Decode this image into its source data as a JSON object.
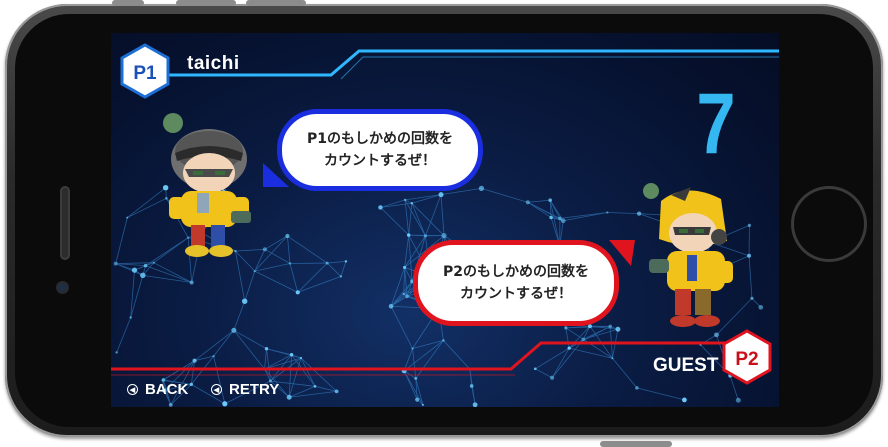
{
  "game": {
    "p1": {
      "badge": "P1",
      "name": "taichi"
    },
    "p2": {
      "badge": "P2",
      "name": "GUEST"
    },
    "score": "7",
    "bubble_p1": {
      "line1": "P1のもしかめの回数を",
      "line2": "カウントするぜ！"
    },
    "bubble_p2": {
      "line1": "P2のもしかめの回数を",
      "line2": "カウントするぜ！"
    },
    "nav": {
      "back": "BACK",
      "retry": "RETRY"
    }
  },
  "colors": {
    "p1": "#1a2ee0",
    "p2": "#e0141e",
    "score": "#35b7f2",
    "accent": "#2fb8ff"
  }
}
